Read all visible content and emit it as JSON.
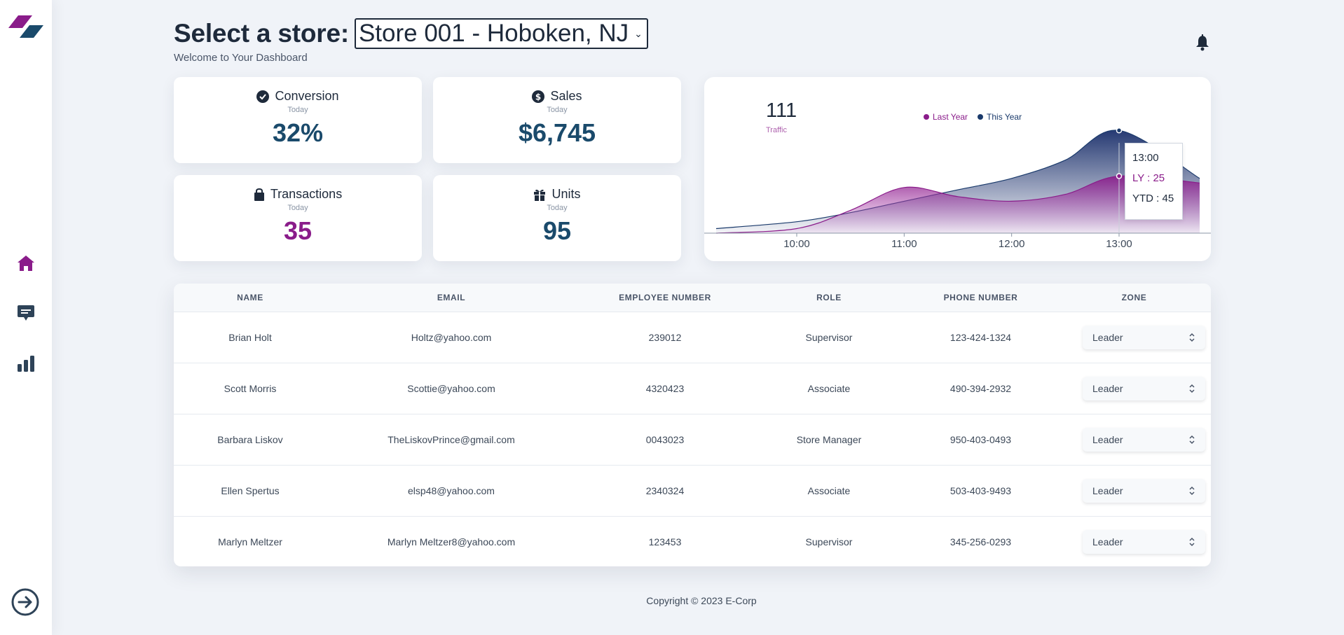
{
  "sidebar": {
    "items": [
      {
        "icon": "home-icon"
      },
      {
        "icon": "chat-icon"
      },
      {
        "icon": "bar-chart-icon"
      }
    ],
    "logout_icon": "arrow-right-circle-icon"
  },
  "header": {
    "title": "Select a store:",
    "store_selected": "Store 001 - Hoboken, NJ",
    "subtitle": "Welcome to Your Dashboard"
  },
  "stats": {
    "conversion": {
      "title": "Conversion",
      "period": "Today",
      "value": "32%"
    },
    "sales": {
      "title": "Sales",
      "period": "Today",
      "value": "$6,745"
    },
    "transactions": {
      "title": "Transactions",
      "period": "Today",
      "value": "35"
    },
    "units": {
      "title": "Units",
      "period": "Today",
      "value": "95"
    }
  },
  "chart": {
    "value": "111",
    "label": "Traffic",
    "tooltip": {
      "time": "13:00",
      "ly": "LY : 25",
      "ytd": "YTD : 45"
    }
  },
  "chart_data": {
    "type": "area",
    "x": [
      "09:15",
      "10:00",
      "10:30",
      "11:00",
      "11:30",
      "12:00",
      "12:30",
      "13:00",
      "13:45"
    ],
    "tick_labels": [
      "10:00",
      "11:00",
      "12:00",
      "13:00"
    ],
    "series": [
      {
        "name": "Last Year",
        "color": "#8a1c8a",
        "values": [
          0,
          2,
          10,
          20,
          16,
          14,
          17,
          25,
          22
        ]
      },
      {
        "name": "This Year",
        "color": "#1a3a6b",
        "values": [
          2,
          5,
          9,
          14,
          19,
          24,
          32,
          45,
          24
        ]
      }
    ],
    "ylim": [
      0,
      50
    ],
    "legend": "top"
  },
  "table": {
    "headers": [
      "NAME",
      "EMAIL",
      "EMPLOYEE NUMBER",
      "ROLE",
      "PHONE NUMBER",
      "ZONE"
    ],
    "rows": [
      {
        "name": "Brian Holt",
        "email": "Holtz@yahoo.com",
        "employee_number": "239012",
        "role": "Supervisor",
        "phone": "123-424-1324",
        "zone": "Leader"
      },
      {
        "name": "Scott Morris",
        "email": "Scottie@yahoo.com",
        "employee_number": "4320423",
        "role": "Associate",
        "phone": "490-394-2932",
        "zone": "Leader"
      },
      {
        "name": "Barbara Liskov",
        "email": "TheLiskovPrince@gmail.com",
        "employee_number": "0043023",
        "role": "Store Manager",
        "phone": "950-403-0493",
        "zone": "Leader"
      },
      {
        "name": "Ellen Spertus",
        "email": "elsp48@yahoo.com",
        "employee_number": "2340324",
        "role": "Associate",
        "phone": "503-403-9493",
        "zone": "Leader"
      },
      {
        "name": "Marlyn Meltzer",
        "email": "Marlyn Meltzer8@yahoo.com",
        "employee_number": "123453",
        "role": "Supervisor",
        "phone": "345-256-0293",
        "zone": "Leader"
      }
    ]
  },
  "footer": {
    "text": "Copyright © 2023 E-Corp"
  },
  "colors": {
    "brand_purple": "#8a1c8a",
    "brand_navy": "#1a4a6b",
    "background": "#f0f3f8"
  }
}
